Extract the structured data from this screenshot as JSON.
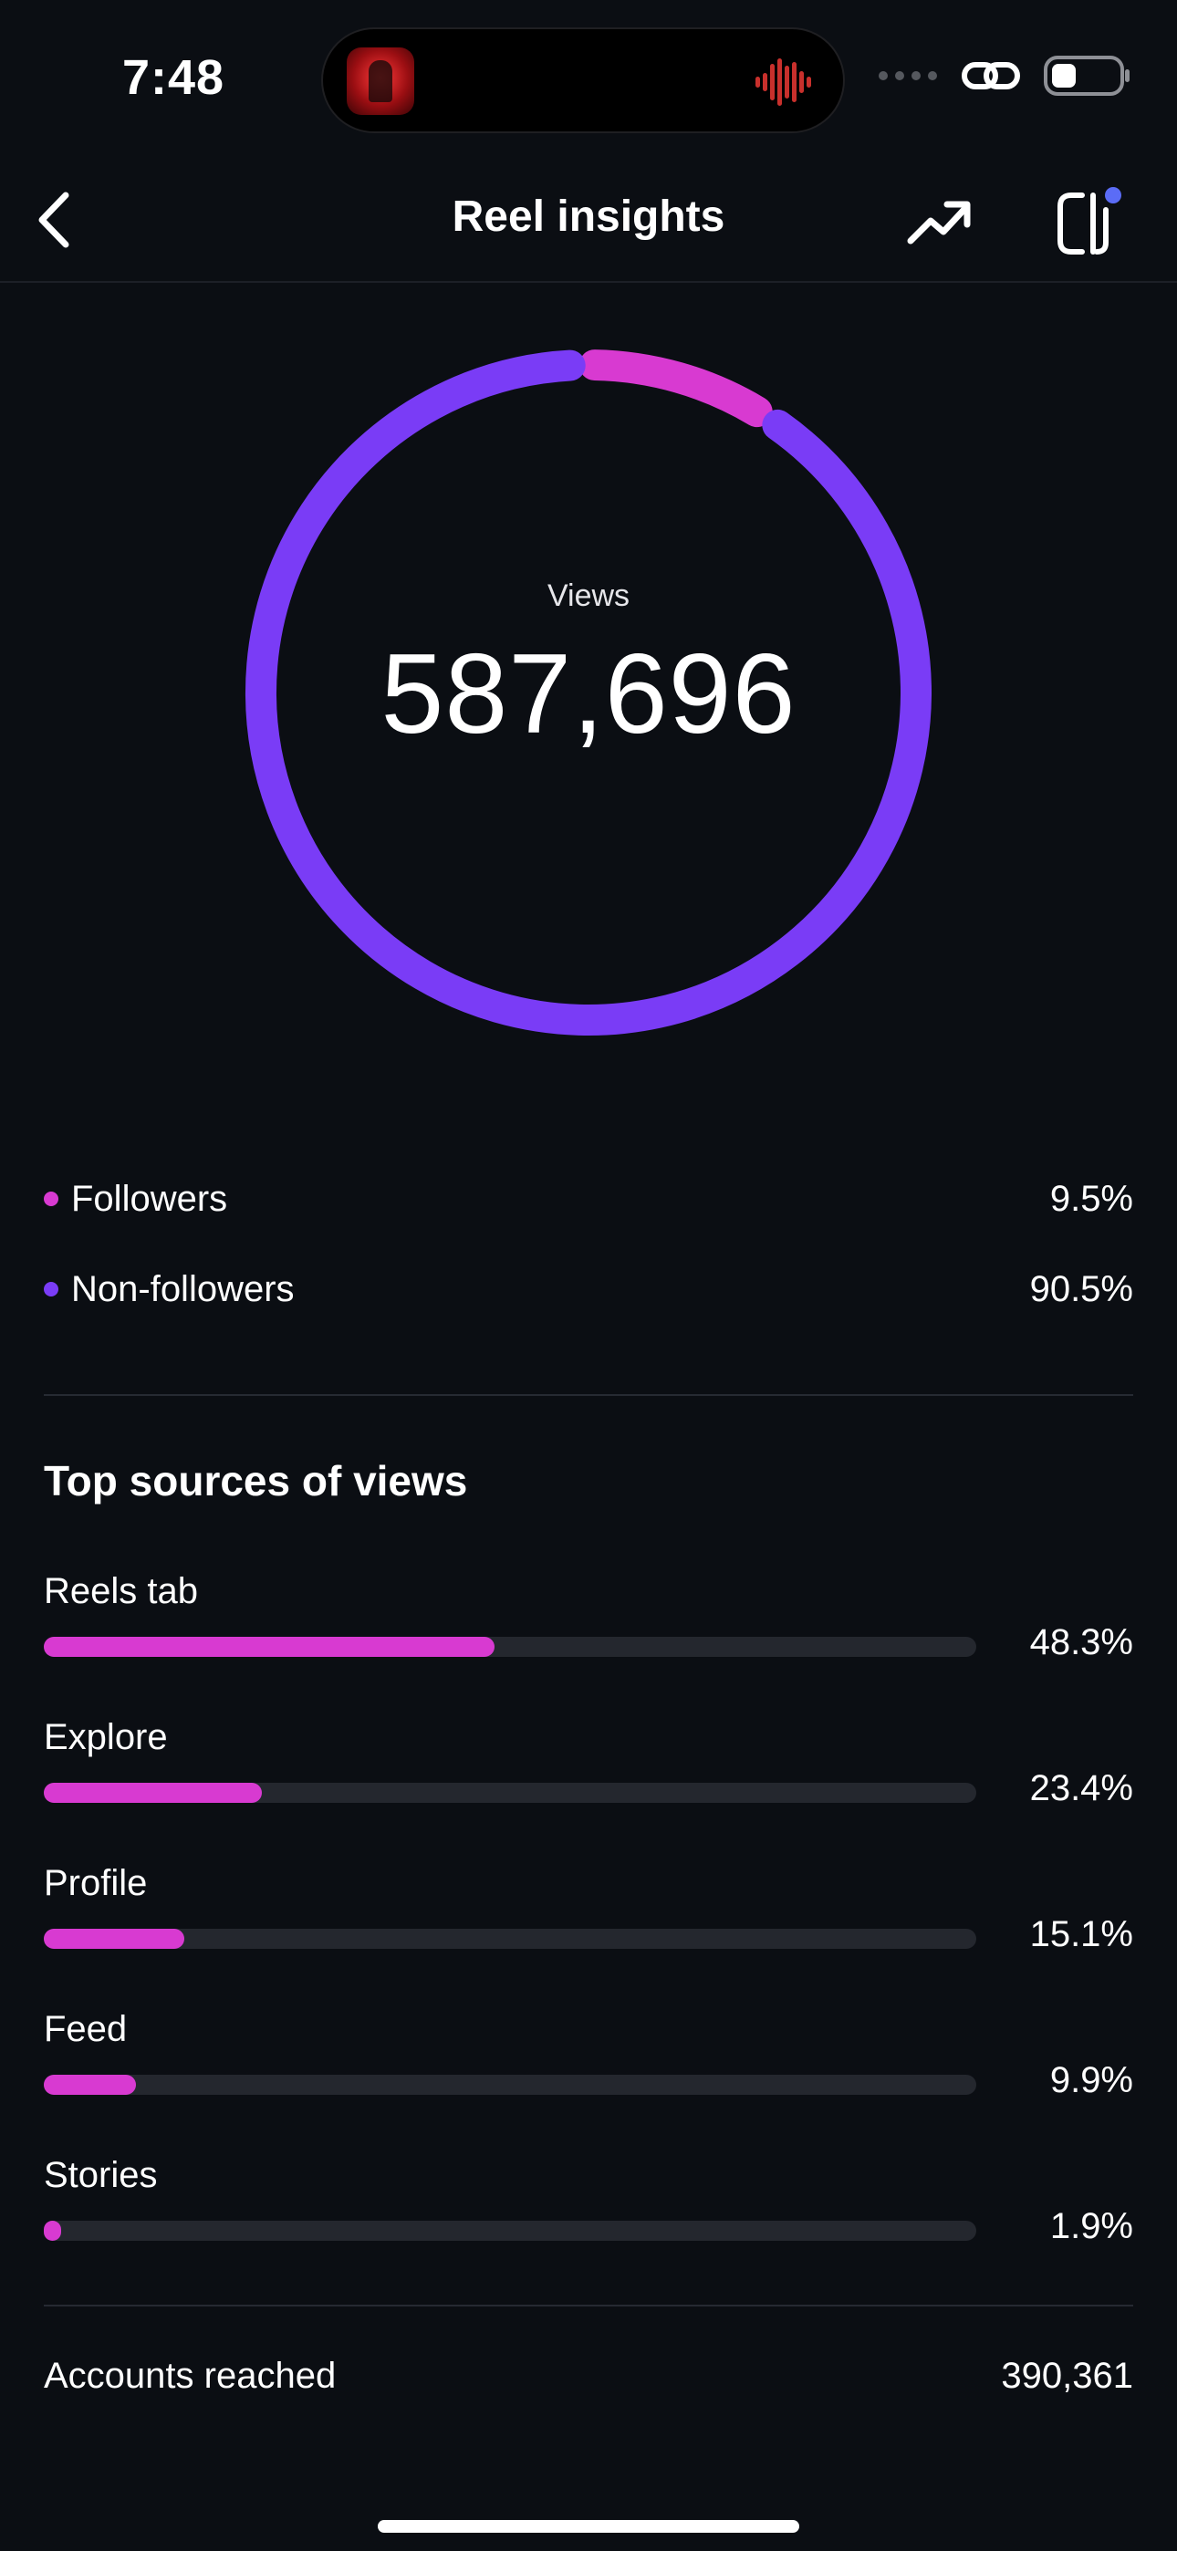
{
  "status_bar": {
    "time": "7:48",
    "island_art_icon": "album-art-icon",
    "island_wave_icon": "audio-waveform-icon",
    "icons": [
      "signal-dots-icon",
      "link-icon",
      "battery-icon"
    ]
  },
  "nav": {
    "title": "Reel insights",
    "back_icon": "chevron-left-icon",
    "trend_icon": "trending-up-icon",
    "panel_icon": "side-panel-icon"
  },
  "views": {
    "label": "Views",
    "value": "587,696"
  },
  "audience": [
    {
      "label": "Followers",
      "value": "9.5%",
      "fraction": 0.095,
      "color": "#d83ad1"
    },
    {
      "label": "Non-followers",
      "value": "90.5%",
      "fraction": 0.905,
      "color": "#7a3cf6"
    }
  ],
  "sources": {
    "title": "Top sources of views",
    "items": [
      {
        "label": "Reels tab",
        "value": "48.3%",
        "fraction": 0.483
      },
      {
        "label": "Explore",
        "value": "23.4%",
        "fraction": 0.234
      },
      {
        "label": "Profile",
        "value": "15.1%",
        "fraction": 0.151
      },
      {
        "label": "Feed",
        "value": "9.9%",
        "fraction": 0.099
      },
      {
        "label": "Stories",
        "value": "1.9%",
        "fraction": 0.019
      }
    ]
  },
  "accounts_reached": {
    "label": "Accounts reached",
    "value": "390,361"
  },
  "colors": {
    "background": "#0b0e13",
    "followers": "#d83ad1",
    "non_followers": "#7a3cf6",
    "bar_track": "#24272e",
    "notification_dot": "#5b6cf6"
  }
}
